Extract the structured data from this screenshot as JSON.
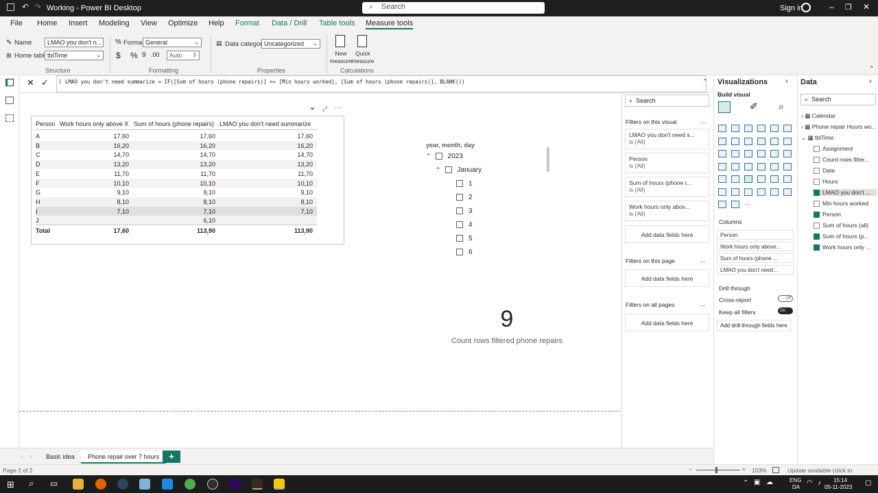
{
  "app": {
    "title": "Working - Power BI Desktop",
    "search_placeholder": "Search",
    "sign_in": "Sign in"
  },
  "menu": {
    "items": [
      "File",
      "Home",
      "Insert",
      "Modeling",
      "View",
      "Optimize",
      "Help",
      "Format",
      "Data / Drill",
      "Table tools",
      "Measure tools"
    ],
    "active": "Measure tools"
  },
  "ribbon": {
    "name_label": "Name",
    "name_value": "LMAO you don't n...",
    "home_table_label": "Home table",
    "home_table_value": "tblTime",
    "structure_label": "Structure",
    "format_label": "Format",
    "format_value": "General",
    "currency_symbol": "$",
    "percent_symbol": "%",
    "comma_symbol": "9",
    "decimals_symbol": ".00",
    "auto_value": "Auto",
    "formatting_label": "Formatting",
    "data_category_label": "Data category",
    "data_category_value": "Uncategorized",
    "properties_label": "Properties",
    "new_measure": "New measure",
    "quick_measure": "Quick measure",
    "calculations_label": "Calculations"
  },
  "formula": {
    "line_no": "1",
    "text": "LMAO you don't need summarize = IF([Sum of hours (phone repairs)] >= [Min hours worked], [Sum of hours (phone repairs)], BLANK())"
  },
  "table_visual": {
    "headers": [
      "Person",
      "Work hours only above X",
      "Sum of hours (phone repairs)",
      "LMAO you don't need summarize"
    ],
    "rows": [
      [
        "A",
        "17,60",
        "17,60",
        "17,60"
      ],
      [
        "B",
        "16,20",
        "16,20",
        "16,20"
      ],
      [
        "C",
        "14,70",
        "14,70",
        "14,70"
      ],
      [
        "D",
        "13,20",
        "13,20",
        "13,20"
      ],
      [
        "E",
        "11,70",
        "11,70",
        "11,70"
      ],
      [
        "F",
        "10,10",
        "10,10",
        "10,10"
      ],
      [
        "G",
        "9,10",
        "9,10",
        "9,10"
      ],
      [
        "H",
        "8,10",
        "8,10",
        "8,10"
      ],
      [
        "I",
        "7,10",
        "7,10",
        "7,10"
      ],
      [
        "J",
        "",
        "6,10",
        ""
      ]
    ],
    "total": [
      "Total",
      "17,60",
      "113,90",
      "113,90"
    ]
  },
  "slicer": {
    "title": "year, month, day",
    "year": "2023",
    "month": "January",
    "days": [
      "1",
      "2",
      "3",
      "4",
      "5",
      "6"
    ]
  },
  "card": {
    "value": "9",
    "label": "Count rows filtered phone repairs"
  },
  "filters": {
    "search": "Search",
    "on_visual": "Filters on this visual",
    "cards": [
      {
        "name": "LMAO you don't need s...",
        "state": "is (All)"
      },
      {
        "name": "Person",
        "state": "is (All)"
      },
      {
        "name": "Sum of hours (phone r...",
        "state": "is (All)"
      },
      {
        "name": "Work hours only abov...",
        "state": "is (All)"
      }
    ],
    "add_fields": "Add data fields here",
    "on_page": "Filters on this page",
    "on_all_pages": "Filters on all pages",
    "more": "..."
  },
  "visualizations": {
    "title": "Visualizations",
    "build_visual": "Build visual",
    "columns_label": "Columns",
    "columns": [
      "Person",
      "Work hours only above...",
      "Sum of hours (phone ...",
      "LMAO you don't need..."
    ],
    "drill_through": "Drill through",
    "cross_report": "Cross-report",
    "cross_report_state": "Off",
    "keep_all_filters": "Keep all filters",
    "keep_all_filters_state": "On",
    "add_drill": "Add drill-through fields here"
  },
  "data_pane": {
    "title": "Data",
    "search": "Search",
    "tables": [
      "Calendar",
      "Phone repair Hours wo...",
      "tblTime"
    ],
    "fields": [
      {
        "name": "Assignment",
        "checked": false
      },
      {
        "name": "Count rows filter...",
        "checked": false
      },
      {
        "name": "Date",
        "checked": false
      },
      {
        "name": "Hours",
        "checked": false
      },
      {
        "name": "LMAO you don't ...",
        "checked": true
      },
      {
        "name": "Min hours worked",
        "checked": false
      },
      {
        "name": "Person",
        "checked": true
      },
      {
        "name": "Sum of hours (all)",
        "checked": false
      },
      {
        "name": "Sum of hours (p...",
        "checked": true
      },
      {
        "name": "Work hours only ...",
        "checked": true
      }
    ]
  },
  "pages": {
    "tabs": [
      "Basic idea",
      "Phone repair over 7 hours"
    ],
    "active": "Phone repair over 7 hours",
    "add": "+"
  },
  "status": {
    "page": "Page 2 of 2",
    "zoom": "103%",
    "update": "Update available (click to download)"
  },
  "taskbar": {
    "lang": "ENG",
    "region": "DA",
    "time": "15:14",
    "date": "05-11-2023"
  },
  "colors": {
    "accent": "#117865",
    "titlebar": "#1f1f1f",
    "ribbon_bg": "#f3f2f1",
    "taskbar": "#1c1c1c"
  }
}
